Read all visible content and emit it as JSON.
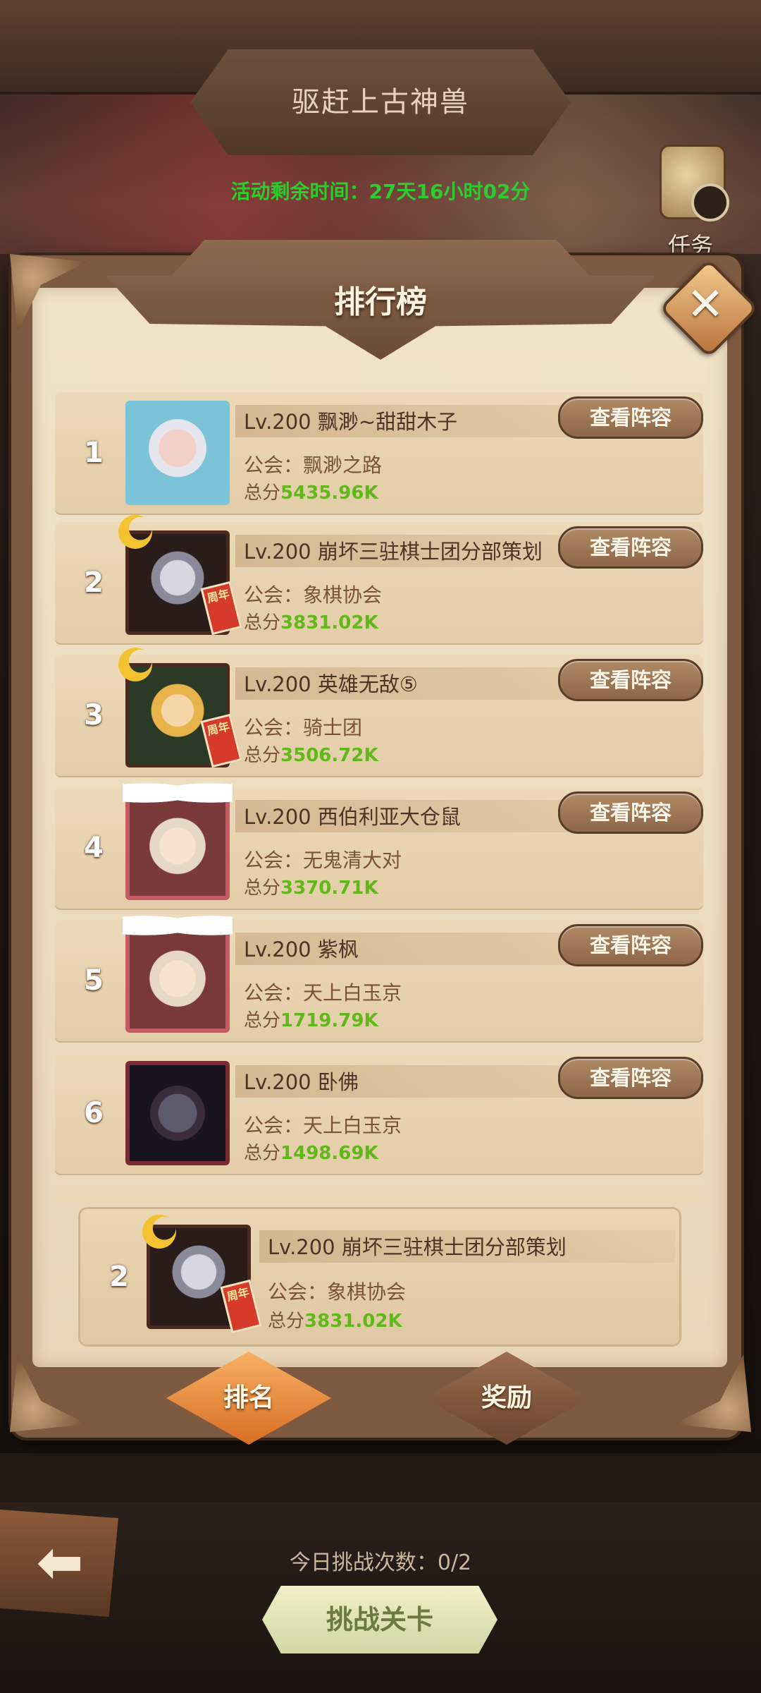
{
  "header": {
    "title": "驱赶上古神兽",
    "timer_label": "活动剩余时间：",
    "timer_value": "27天16小时02分",
    "quest_label": "任务"
  },
  "modal": {
    "title": "排行榜",
    "close_glyph": "✕"
  },
  "leaderboard": [
    {
      "rank": "1",
      "name": "Lv.200 飘渺~甜甜木子",
      "guild": "公会：飘渺之路",
      "score_label": "总分",
      "score": "5435.96K",
      "button": "查看阵容"
    },
    {
      "rank": "2",
      "name": "Lv.200 崩坏三驻棋士团分部策划",
      "guild": "公会：象棋协会",
      "score_label": "总分",
      "score": "3831.02K",
      "button": "查看阵容"
    },
    {
      "rank": "3",
      "name": "Lv.200 英雄无敌⑤",
      "guild": "公会：骑士团",
      "score_label": "总分",
      "score": "3506.72K",
      "button": "查看阵容"
    },
    {
      "rank": "4",
      "name": "Lv.200 西伯利亚大仓鼠",
      "guild": "公会：无鬼清大对",
      "score_label": "总分",
      "score": "3370.71K",
      "button": "查看阵容"
    },
    {
      "rank": "5",
      "name": "Lv.200 紫枫",
      "guild": "公会：天上白玉京",
      "score_label": "总分",
      "score": "1719.79K",
      "button": "查看阵容"
    },
    {
      "rank": "6",
      "name": "Lv.200 卧佛",
      "guild": "公会：天上白玉京",
      "score_label": "总分",
      "score": "1498.69K",
      "button": "查看阵容"
    }
  ],
  "my_rank": {
    "rank": "2",
    "name": "Lv.200 崩坏三驻棋士团分部策划",
    "guild": "公会：象棋协会",
    "score_label": "总分",
    "score": "3831.02K",
    "anniversary_badge": "周年"
  },
  "tabs": {
    "rank": "排名",
    "reward": "奖励"
  },
  "footer": {
    "attempts": "今日挑战次数：0/2",
    "challenge": "挑战关卡"
  },
  "icons": {
    "back": "back-arrow-icon",
    "quest": "scroll-clock-icon",
    "close": "close-icon"
  },
  "colors": {
    "score_green": "#62b81a",
    "timer_green": "#2ecc2e",
    "parchment": "#f0e2c8"
  }
}
